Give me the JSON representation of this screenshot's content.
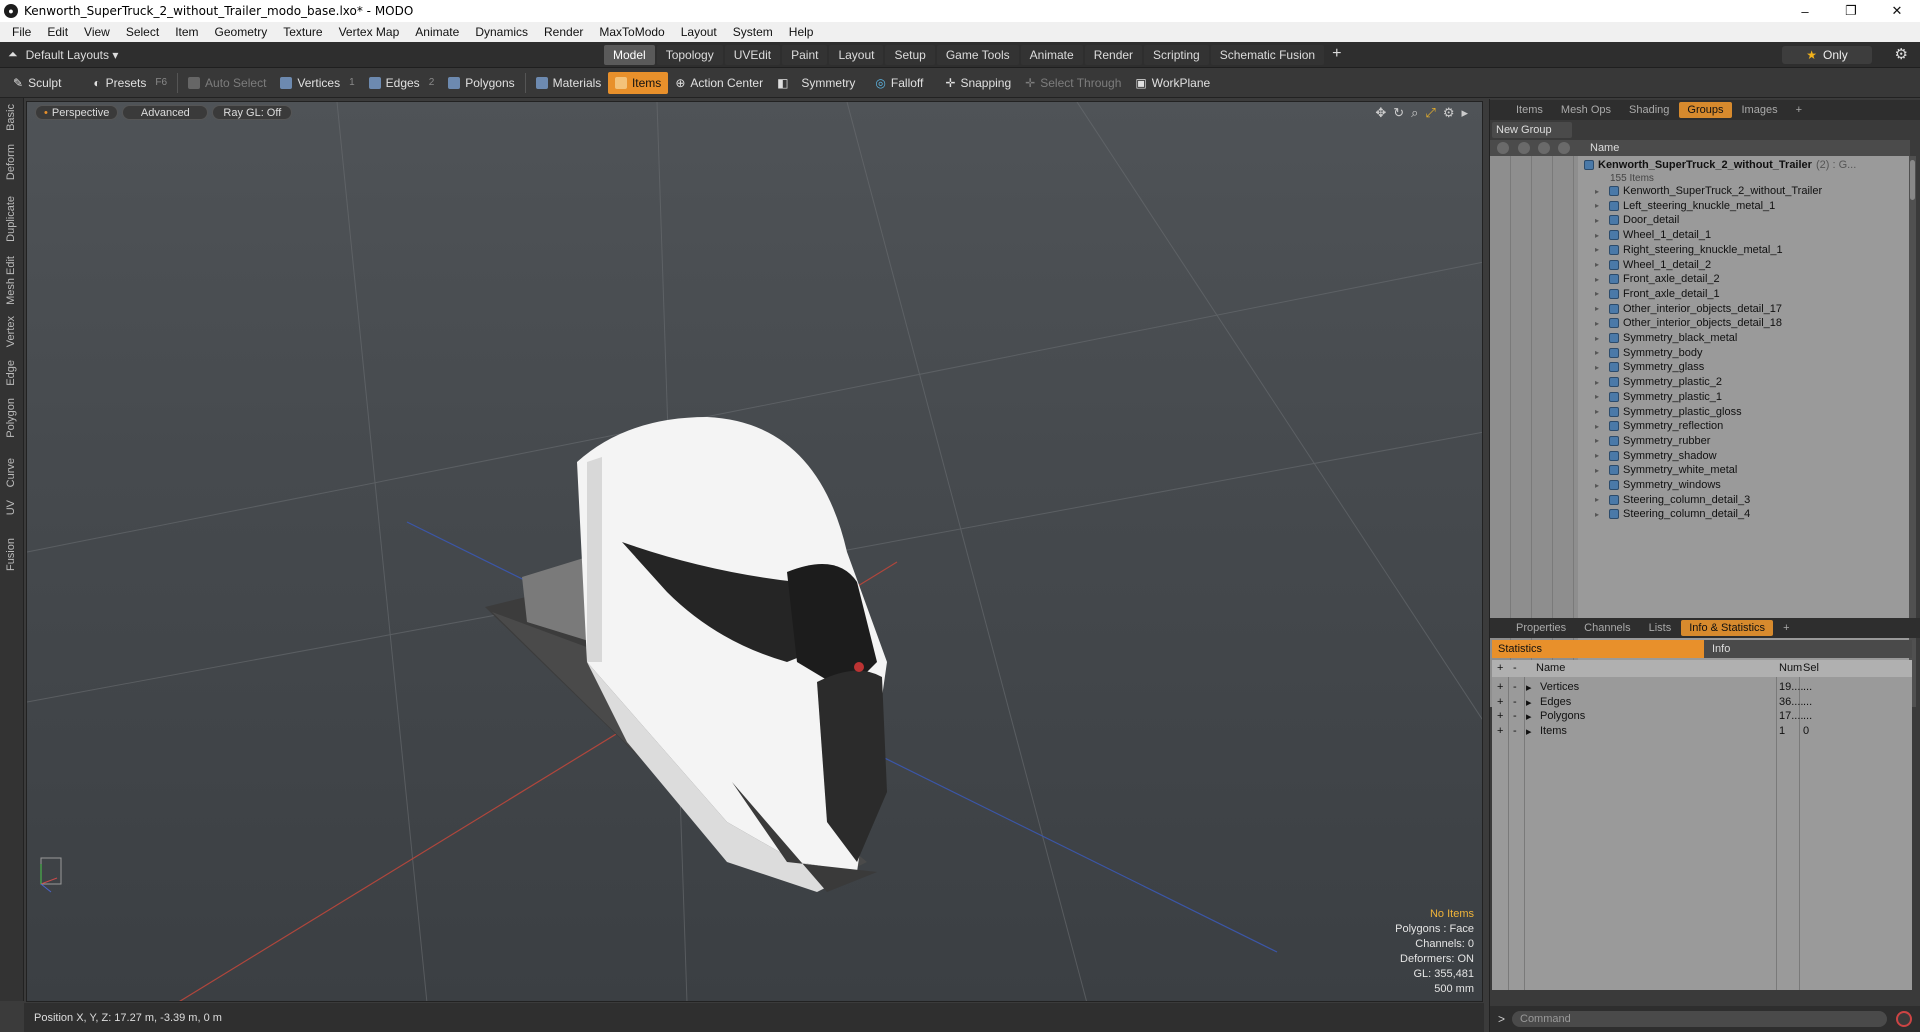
{
  "window": {
    "title": "Kenworth_SuperTruck_2_without_Trailer_modo_base.lxo* - MODO"
  },
  "menu": [
    "File",
    "Edit",
    "View",
    "Select",
    "Item",
    "Geometry",
    "Texture",
    "Vertex Map",
    "Animate",
    "Dynamics",
    "Render",
    "MaxToModo",
    "Layout",
    "System",
    "Help"
  ],
  "layouts": {
    "label": "Default Layouts ▾"
  },
  "tabs": [
    {
      "label": "Model"
    },
    {
      "label": "Topology"
    },
    {
      "label": "UVEdit"
    },
    {
      "label": "Paint"
    },
    {
      "label": "Layout"
    },
    {
      "label": "Setup"
    },
    {
      "label": "Game Tools"
    },
    {
      "label": "Animate"
    },
    {
      "label": "Render"
    },
    {
      "label": "Scripting"
    },
    {
      "label": "Schematic Fusion"
    }
  ],
  "only_label": "Only",
  "toolbar": {
    "sculpt": "Sculpt",
    "presets": "Presets",
    "presets_key": "F6",
    "auto_select": "Auto Select",
    "vertices": "Vertices",
    "vertices_n": "1",
    "edges": "Edges",
    "edges_n": "2",
    "polygons": "Polygons",
    "materials": "Materials",
    "items": "Items",
    "action_center": "Action Center",
    "symmetry": "Symmetry",
    "falloff": "Falloff",
    "snapping": "Snapping",
    "select_through": "Select Through",
    "workplane": "WorkPlane"
  },
  "left_tabs": [
    "Basic",
    "Deform",
    "Duplicate",
    "Mesh Edit",
    "Vertex",
    "Edge",
    "Polygon",
    "Curve",
    "UV",
    "Fusion"
  ],
  "viewport": {
    "view": "Perspective",
    "advanced": "Advanced",
    "raygl": "Ray GL: Off",
    "info": {
      "no_items": "No Items",
      "polygons": "Polygons : Face",
      "channels": "Channels: 0",
      "deformers": "Deformers: ON",
      "gl": "GL: 355,481",
      "scale": "500 mm"
    }
  },
  "status": {
    "position": "Position X, Y, Z:   17.27 m, -3.39 m, 0 m"
  },
  "right_tabs_top": [
    {
      "label": "Items"
    },
    {
      "label": "Mesh Ops"
    },
    {
      "label": "Shading"
    },
    {
      "label": "Groups"
    },
    {
      "label": "Images"
    }
  ],
  "groups": {
    "new_group": "New Group",
    "col_name": "Name",
    "root": "Kenworth_SuperTruck_2_without_Trailer",
    "root_suffix": "(2) : G...",
    "root_count": "155 Items",
    "items": [
      "Kenworth_SuperTruck_2_without_Trailer",
      "Left_steering_knuckle_metal_1",
      "Door_detail",
      "Wheel_1_detail_1",
      "Right_steering_knuckle_metal_1",
      "Wheel_1_detail_2",
      "Front_axle_detail_2",
      "Front_axle_detail_1",
      "Other_interior_objects_detail_17",
      "Other_interior_objects_detail_18",
      "Symmetry_black_metal",
      "Symmetry_body",
      "Symmetry_glass",
      "Symmetry_plastic_2",
      "Symmetry_plastic_1",
      "Symmetry_plastic_gloss",
      "Symmetry_reflection",
      "Symmetry_rubber",
      "Symmetry_shadow",
      "Symmetry_white_metal",
      "Symmetry_windows",
      "Steering_column_detail_3",
      "Steering_column_detail_4"
    ]
  },
  "right_tabs_bottom": [
    {
      "label": "Properties"
    },
    {
      "label": "Channels"
    },
    {
      "label": "Lists"
    },
    {
      "label": "Info & Statistics"
    }
  ],
  "stats": {
    "tab_statistics": "Statistics",
    "tab_info": "Info",
    "col_name": "Name",
    "col_num": "Num",
    "col_sel": "Sel",
    "rows": [
      {
        "name": "Vertices",
        "num": "19....",
        "sel": "..."
      },
      {
        "name": "Edges",
        "num": "36....",
        "sel": "..."
      },
      {
        "name": "Polygons",
        "num": "17....",
        "sel": "..."
      },
      {
        "name": "Items",
        "num": "1",
        "sel": "0"
      }
    ]
  },
  "command": {
    "placeholder": "Command"
  }
}
